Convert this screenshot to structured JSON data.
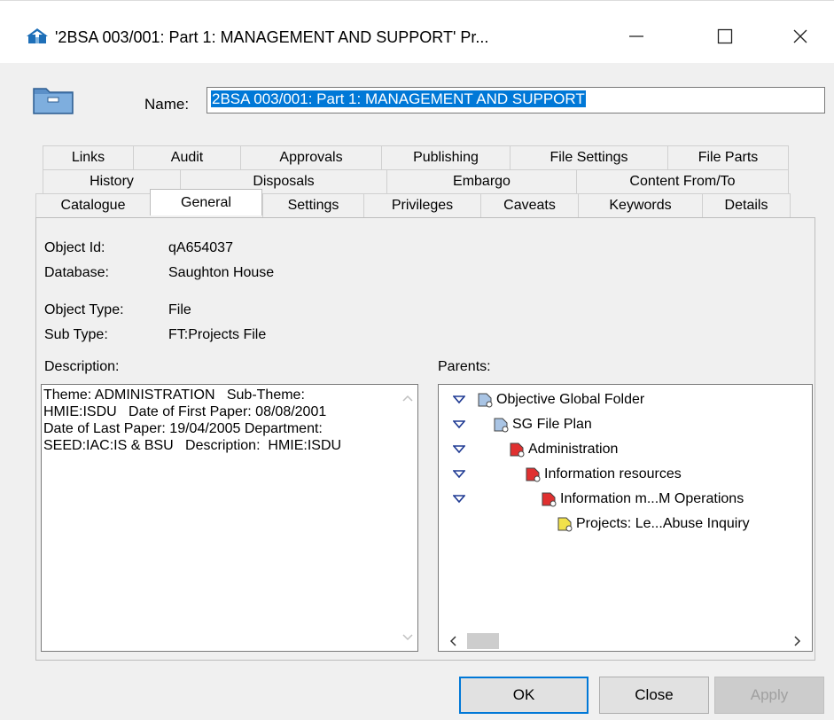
{
  "window": {
    "title": "'2BSA 003/001: Part 1: MANAGEMENT AND SUPPORT' Pr...",
    "minimize_glyph": "—",
    "maximize_glyph": "☐",
    "close_glyph": "✕"
  },
  "name_field": {
    "label": "Name:",
    "value": "2BSA 003/001: Part 1: MANAGEMENT AND SUPPORT"
  },
  "tabs": {
    "row1": [
      "Links",
      "Audit",
      "Approvals",
      "Publishing",
      "File Settings",
      "File Parts"
    ],
    "row2": [
      "History",
      "Disposals",
      "Embargo",
      "Content From/To"
    ],
    "row3": [
      "Catalogue",
      "General",
      "Settings",
      "Privileges",
      "Caveats",
      "Keywords",
      "Details"
    ],
    "active": "General"
  },
  "general": {
    "object_id_label": "Object Id:",
    "object_id": "qA654037",
    "database_label": "Database:",
    "database": "Saughton House",
    "object_type_label": "Object Type:",
    "object_type": "File",
    "sub_type_label": "Sub Type:",
    "sub_type": "FT:Projects File",
    "description_label": "Description:",
    "description": "Theme: ADMINISTRATION   Sub-Theme: HMIE:ISDU   Date of First Paper: 08/08/2001   Date of Last Paper: 19/04/2005 Department: SEED:IAC:IS & BSU   Description:  HMIE:ISDU",
    "parents_label": "Parents:"
  },
  "parents": [
    {
      "label": "Objective Global Folder",
      "color": "#a9c4e4"
    },
    {
      "label": "SG File Plan",
      "color": "#a9c4e4"
    },
    {
      "label": "Administration",
      "color": "#e03030"
    },
    {
      "label": "Information resources",
      "color": "#e03030"
    },
    {
      "label": "Information m...M Operations",
      "color": "#e03030"
    },
    {
      "label": "Projects: Le...Abuse Inquiry",
      "color": "#f2e24a"
    }
  ],
  "buttons": {
    "ok": "OK",
    "close": "Close",
    "apply": "Apply"
  },
  "colors": {
    "selection": "#0078d7",
    "button_default_border": "#0078d7",
    "disabled_text": "#a0a0a0"
  }
}
